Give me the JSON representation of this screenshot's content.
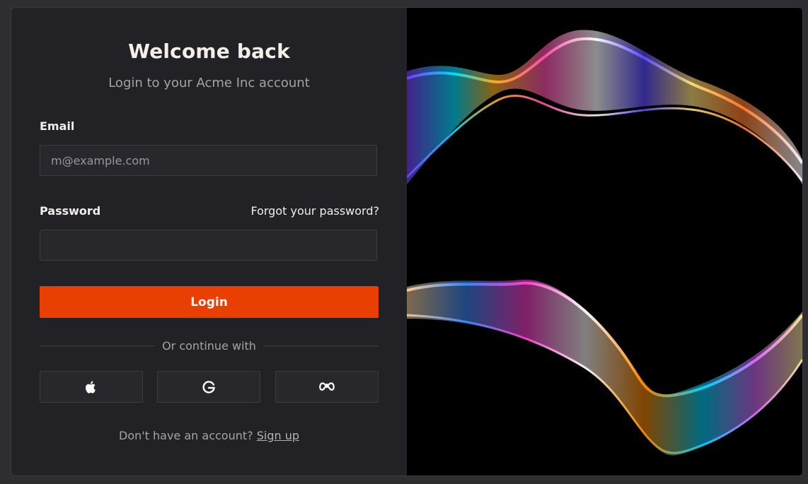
{
  "login": {
    "title": "Welcome back",
    "subtitle": "Login to your Acme Inc account",
    "email_label": "Email",
    "email_placeholder": "m@example.com",
    "email_value": "",
    "password_label": "Password",
    "password_value": "",
    "forgot_link": "Forgot your password?",
    "login_button": "Login",
    "divider_text": "Or continue with",
    "social": [
      {
        "icon": "apple-icon"
      },
      {
        "icon": "google-icon"
      },
      {
        "icon": "meta-icon"
      }
    ],
    "signup_prompt": "Don't have an account?",
    "signup_link": "Sign up"
  },
  "colors": {
    "background": "#2d2d32",
    "card": "#222226",
    "accent": "#ea3f02",
    "image_panel": "#000000"
  }
}
